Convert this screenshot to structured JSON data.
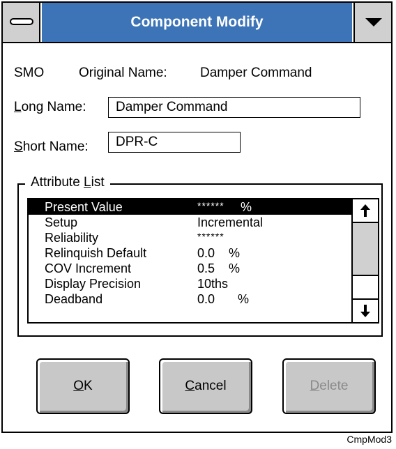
{
  "window": {
    "title": "Component Modify",
    "system_menu_icon": "system-menu-icon",
    "dropdown_icon": "dropdown-arrow-icon"
  },
  "header": {
    "object_type": "SMO",
    "original_name_label": "Original Name:",
    "original_name_value": "Damper Command"
  },
  "long_name": {
    "label_mnemonic": "L",
    "label_rest": "ong Name:",
    "value": "Damper Command"
  },
  "short_name": {
    "label_mnemonic": "S",
    "label_rest": "hort Name:",
    "value": "DPR-C"
  },
  "attribute_list": {
    "label_prefix": "Attribute ",
    "label_mnemonic": "L",
    "label_rest": "ist",
    "rows": [
      {
        "name": "Present Value",
        "value": "******",
        "unit": "%",
        "selected": true
      },
      {
        "name": "Setup",
        "value": "Incremental",
        "unit": "",
        "selected": false
      },
      {
        "name": "Reliability",
        "value": "******",
        "unit": "",
        "selected": false
      },
      {
        "name": "Relinquish Default",
        "value": "0.0",
        "unit": "%",
        "selected": false
      },
      {
        "name": "COV Increment",
        "value": "0.5",
        "unit": "%",
        "selected": false
      },
      {
        "name": "Display Precision",
        "value": "10ths",
        "unit": "",
        "selected": false
      },
      {
        "name": "Deadband",
        "value": "0.0",
        "unit": "%",
        "selected": false
      }
    ],
    "scroll_up_icon": "arrow-up-icon",
    "scroll_down_icon": "arrow-down-icon"
  },
  "buttons": {
    "ok": {
      "mnemonic": "O",
      "rest": "K"
    },
    "cancel": {
      "mnemonic": "C",
      "rest": "ancel"
    },
    "delete": {
      "mnemonic": "D",
      "rest": "elete",
      "disabled": true
    }
  },
  "figure_label": "CmpMod3"
}
